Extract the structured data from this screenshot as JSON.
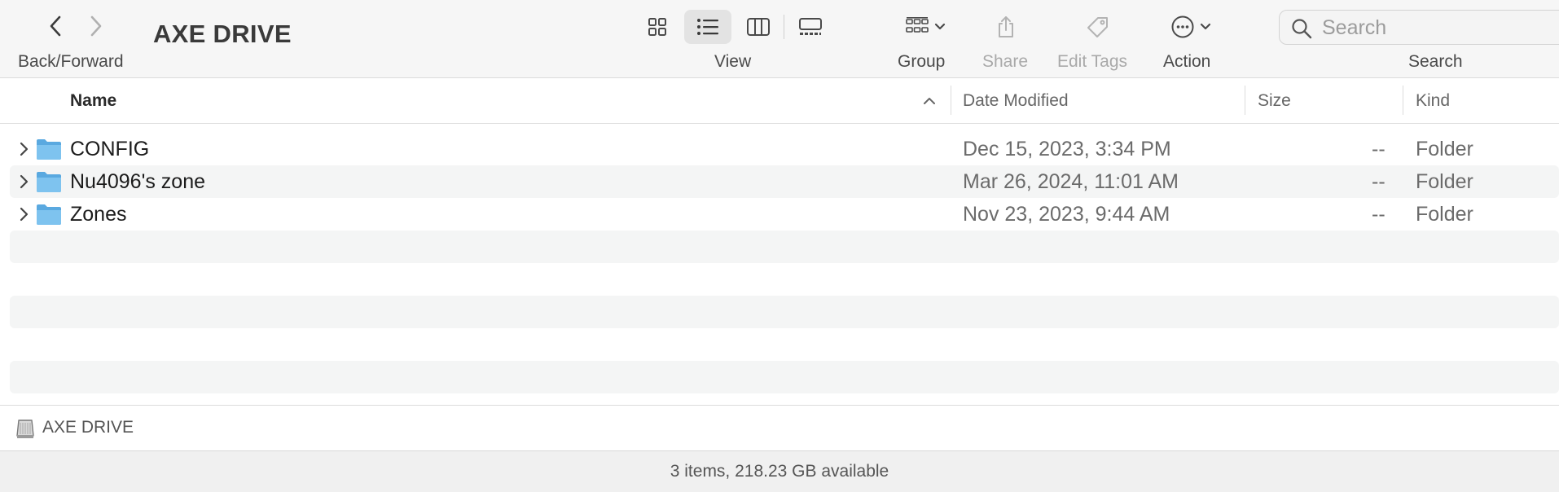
{
  "window": {
    "title": "AXE DRIVE"
  },
  "toolbar": {
    "nav_label": "Back/Forward",
    "view_label": "View",
    "group_label": "Group",
    "share_label": "Share",
    "edit_tags_label": "Edit Tags",
    "action_label": "Action",
    "search_label": "Search",
    "search_placeholder": "Search",
    "active_view": "list"
  },
  "columns": {
    "name": "Name",
    "date_modified": "Date Modified",
    "size": "Size",
    "kind": "Kind",
    "sort": "ascending"
  },
  "files": [
    {
      "name": "CONFIG",
      "date_modified": "Dec 15, 2023, 3:34 PM",
      "size": "--",
      "kind": "Folder"
    },
    {
      "name": "Nu4096's zone",
      "date_modified": "Mar 26, 2024, 11:01 AM",
      "size": "--",
      "kind": "Folder"
    },
    {
      "name": "Zones",
      "date_modified": "Nov 23, 2023, 9:44 AM",
      "size": "--",
      "kind": "Folder"
    }
  ],
  "pathbar": {
    "location": "AXE DRIVE"
  },
  "status": {
    "text": "3 items, 218.23 GB available"
  },
  "colors": {
    "folder": "#7ec3ef",
    "folder_dark": "#5aa9e0",
    "row_alt": "#f4f5f5"
  }
}
